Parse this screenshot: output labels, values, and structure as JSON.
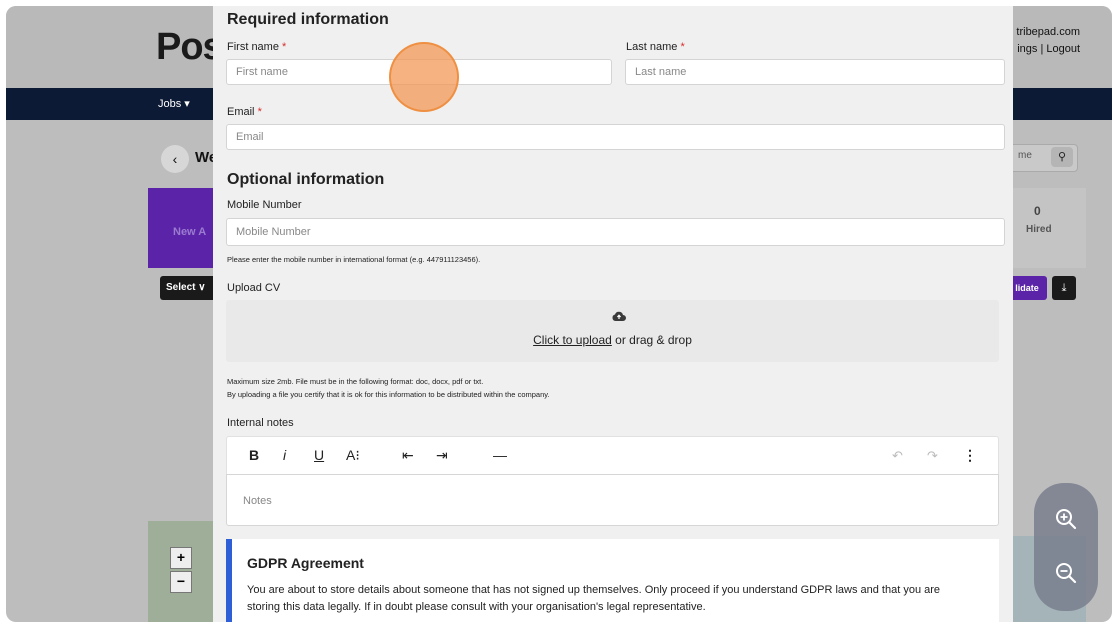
{
  "background": {
    "logo": "Pos",
    "account_line1": "tribepad.com",
    "account_line2": "ings | Logout",
    "nav_jobs": "Jobs ▾",
    "back_glyph": "‹",
    "page_title_fragment": "We",
    "search_placeholder_fragment": "me",
    "purple_tile_label": "New A",
    "hired_count": "0",
    "hired_label": "Hired",
    "select_label": "Select ∨",
    "candidate_button": "lidate",
    "download_glyph": "⤓",
    "map_zoom_in": "+",
    "map_zoom_out": "−"
  },
  "form": {
    "required_title": "Required information",
    "first_name_label": "First name",
    "first_name_placeholder": "First name",
    "last_name_label": "Last name",
    "last_name_placeholder": "Last name",
    "email_label": "Email",
    "email_placeholder": "Email",
    "required_marker": "*",
    "optional_title": "Optional information",
    "mobile_label": "Mobile Number",
    "mobile_placeholder": "Mobile Number",
    "mobile_hint": "Please enter the mobile number in international format (e.g. 447911123456).",
    "upload_label": "Upload CV",
    "upload_link": "Click to upload",
    "upload_rest": " or drag & drop",
    "upload_hint_1": "Maximum size 2mb. File must be in the following format: doc, docx, pdf or txt.",
    "upload_hint_2": "By uploading a file you certify that it is ok for this information to be distributed within the company.",
    "notes_label": "Internal notes",
    "notes_placeholder": "Notes",
    "toolbar": {
      "bold": "B",
      "italic": "i",
      "underline": "U",
      "font_size": "A⁝",
      "outdent": "⇤",
      "indent": "⇥",
      "hr": "—",
      "undo": "↶",
      "redo": "↷",
      "more": "⋮"
    }
  },
  "gdpr": {
    "title": "GDPR Agreement",
    "text": "You are about to store details about someone that has not signed up themselves. Only proceed if you understand GDPR laws and that you are storing this data legally. If in doubt please consult with your organisation's legal representative."
  },
  "colors": {
    "nav": "#0d1a36",
    "accent_purple": "#5b24a8",
    "gdpr_border": "#2f5fd6",
    "required": "#d92c2c",
    "cursor": "#f29650"
  },
  "zoom_controls": {
    "zoom_in_icon": "zoom-in-icon",
    "zoom_out_icon": "zoom-out-icon"
  }
}
